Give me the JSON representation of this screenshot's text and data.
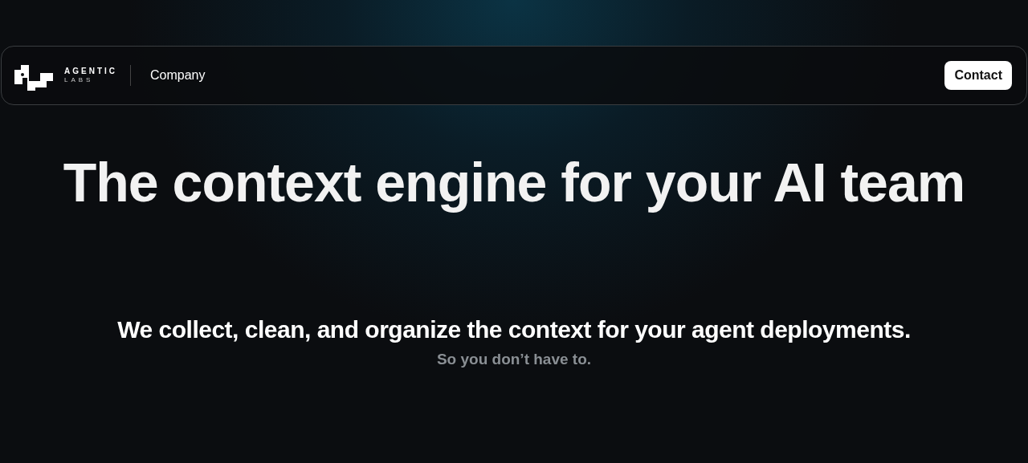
{
  "nav": {
    "logo": {
      "name": "AGENTIC",
      "sub": "LABS"
    },
    "links": [
      {
        "label": "Company"
      }
    ],
    "button": "Contact"
  },
  "hero": {
    "title": "The context engine for your AI team",
    "subtitle": "We collect, clean, and organize the context for your agent deployments.",
    "note": "So you don’t have to."
  }
}
